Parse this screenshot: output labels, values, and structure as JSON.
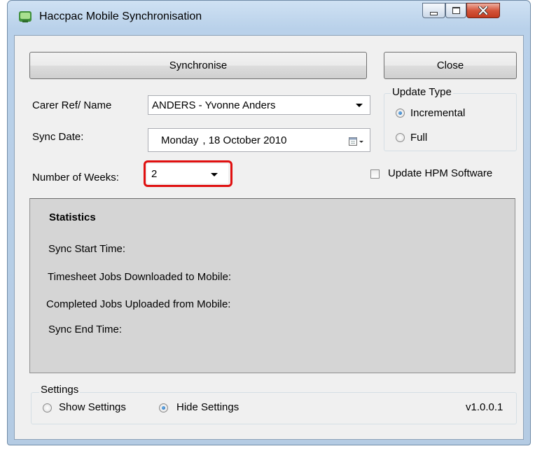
{
  "window": {
    "title": "Haccpac Mobile Synchronisation"
  },
  "toolbar": {
    "synchronise_label": "Synchronise",
    "close_label": "Close"
  },
  "form": {
    "carer_label": "Carer Ref/ Name",
    "carer_value": "ANDERS - Yvonne Anders",
    "sync_date_label": "Sync Date:",
    "sync_date_day": "Monday",
    "sync_date_rest": ", 18  October  2010",
    "weeks_label": "Number of Weeks:",
    "weeks_value": "2"
  },
  "update_type": {
    "legend": "Update Type",
    "incremental_label": "Incremental",
    "full_label": "Full",
    "selected": "Incremental"
  },
  "update_hpm": {
    "label": "Update HPM Software",
    "checked": false
  },
  "statistics": {
    "heading": "Statistics",
    "start_time_label": "Sync Start Time:",
    "downloaded_label": "Timesheet Jobs Downloaded to Mobile:",
    "uploaded_label": "Completed Jobs Uploaded from Mobile:",
    "end_time_label": "Sync End Time:"
  },
  "settings": {
    "legend": "Settings",
    "show_label": "Show Settings",
    "hide_label": "Hide Settings",
    "selected": "Hide Settings",
    "version": "v1.0.0.1"
  },
  "colors": {
    "highlight": "#e01010",
    "stats_background": "#d5d5d5"
  }
}
